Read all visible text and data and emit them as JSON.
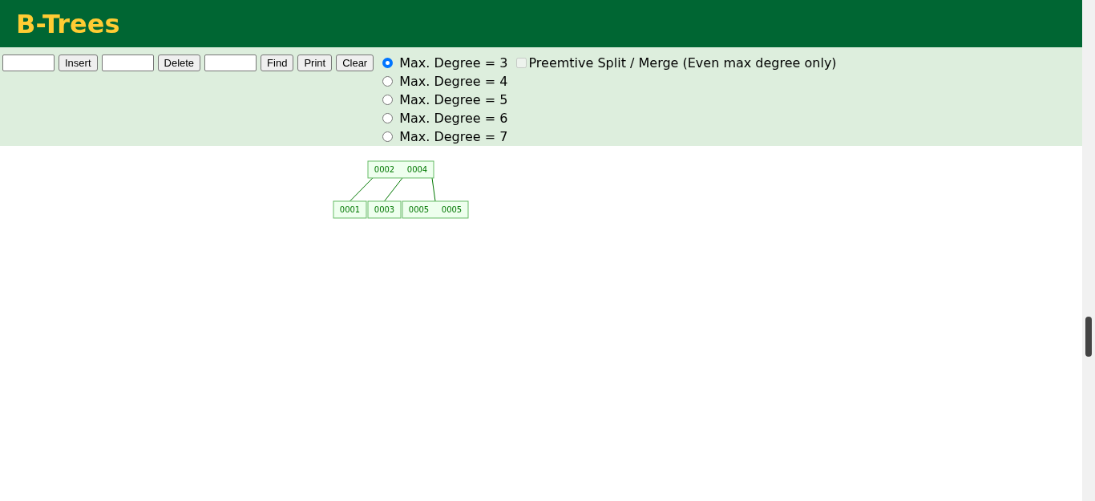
{
  "header": {
    "title": "B-Trees"
  },
  "controls": [
    {
      "kind": "field"
    },
    {
      "kind": "button",
      "label": "Insert"
    },
    {
      "kind": "field"
    },
    {
      "kind": "button",
      "label": "Delete"
    },
    {
      "kind": "field"
    },
    {
      "kind": "button",
      "label": "Find"
    },
    {
      "kind": "button",
      "label": "Print"
    },
    {
      "kind": "button",
      "label": "Clear"
    }
  ],
  "degrees": [
    {
      "label": "Max. Degree = 3",
      "selected": true
    },
    {
      "label": "Max. Degree = 4",
      "selected": false
    },
    {
      "label": "Max. Degree = 5",
      "selected": false
    },
    {
      "label": "Max. Degree = 6",
      "selected": false
    },
    {
      "label": "Max. Degree = 7",
      "selected": false
    }
  ],
  "preemptive": {
    "label": "Preemtive Split / Merge (Even max degree only)",
    "checked": false,
    "disabled": true
  },
  "tree": {
    "keys": [
      "0002",
      "0004"
    ],
    "children": [
      {
        "keys": [
          "0001"
        ]
      },
      {
        "keys": [
          "0003"
        ]
      },
      {
        "keys": [
          "0005",
          "0005"
        ]
      }
    ]
  }
}
